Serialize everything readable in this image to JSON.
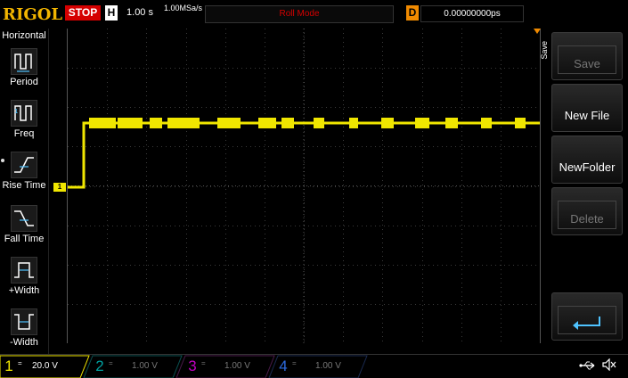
{
  "header": {
    "brand": "RIGOL",
    "run_state": "STOP",
    "timebase_label": "H",
    "timebase_value": "1.00 s",
    "sample_rate": "1.00MSa/s",
    "mode": "Roll Mode",
    "delay_label": "D",
    "delay_value": "0.00000000ps"
  },
  "left_menu": {
    "title": "Horizontal",
    "items": [
      {
        "label": "Period",
        "icon": "period-icon"
      },
      {
        "label": "Freq",
        "icon": "freq-icon"
      },
      {
        "label": "Rise Time",
        "icon": "rise-time-icon"
      },
      {
        "label": "Fall Time",
        "icon": "fall-time-icon"
      },
      {
        "label": "+Width",
        "icon": "plus-width-icon"
      },
      {
        "label": "-Width",
        "icon": "minus-width-icon"
      }
    ]
  },
  "right_menu": {
    "title": "Save",
    "buttons": [
      {
        "label": "Save",
        "enabled": false
      },
      {
        "label": "New File",
        "enabled": true
      },
      {
        "label": "NewFolder",
        "enabled": true
      },
      {
        "label": "Delete",
        "enabled": false
      },
      {
        "label": "",
        "icon": "enter-icon",
        "enabled": true
      }
    ]
  },
  "channels": [
    {
      "num": "1",
      "coupling": "=",
      "scale": "20.0 V",
      "color": "#f0e600",
      "active": true
    },
    {
      "num": "2",
      "coupling": "=",
      "scale": "1.00 V",
      "color": "#00a0a0",
      "active": false
    },
    {
      "num": "3",
      "coupling": "=",
      "scale": "1.00 V",
      "color": "#c000c0",
      "active": false
    },
    {
      "num": "4",
      "coupling": "=",
      "scale": "1.00 V",
      "color": "#2d6be0",
      "active": false
    }
  ],
  "plot": {
    "ch1_marker": "1",
    "trace_color": "#f0e600",
    "grid": true,
    "grid_divisions": {
      "x": 12,
      "y": 8
    }
  },
  "status": {
    "usb_icon": "usb-icon",
    "speaker_icon": "speaker-muted-icon"
  }
}
